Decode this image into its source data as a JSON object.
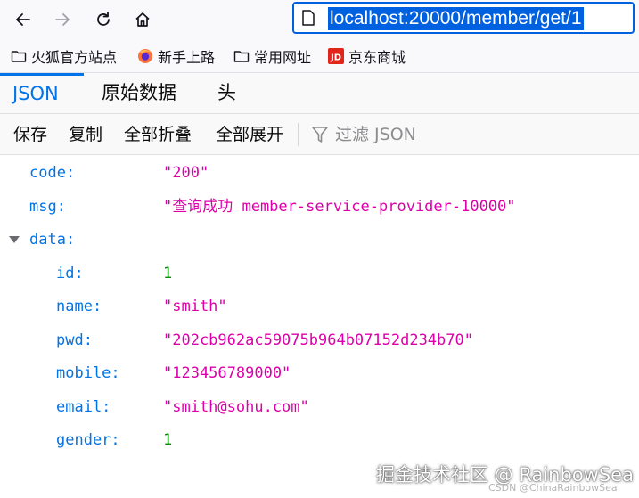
{
  "browser": {
    "url": "localhost:20000/member/get/1",
    "bookmarks": [
      {
        "label": "火狐官方站点",
        "icon": "folder-icon"
      },
      {
        "label": "新手上路",
        "icon": "firefox-icon"
      },
      {
        "label": "常用网址",
        "icon": "folder-icon"
      },
      {
        "label": "京东商城",
        "icon": "jd-icon"
      }
    ]
  },
  "viewer": {
    "tabs": [
      "JSON",
      "原始数据",
      "头"
    ],
    "toolbar": {
      "save": "保存",
      "copy": "复制",
      "collapse_all": "全部折叠",
      "expand_all": "全部展开",
      "filter_placeholder": "过滤 JSON"
    }
  },
  "json": {
    "code": {
      "key": "code:",
      "value": "\"200\""
    },
    "msg": {
      "key": "msg:",
      "value": "\"查询成功 member-service-provider-10000\""
    },
    "data": {
      "key": "data:",
      "id": {
        "key": "id:",
        "value": "1"
      },
      "name": {
        "key": "name:",
        "value": "\"smith\""
      },
      "pwd": {
        "key": "pwd:",
        "value": "\"202cb962ac59075b964b07152d234b70\""
      },
      "mobile": {
        "key": "mobile:",
        "value": "\"123456789000\""
      },
      "email": {
        "key": "email:",
        "value": "\"smith@sohu.com\""
      },
      "gender": {
        "key": "gender:",
        "value": "1"
      }
    }
  },
  "watermark": {
    "main": "掘金技术社区 @ RainbowSea",
    "small": "CSDN @ChinaRainbowSea"
  },
  "colors": {
    "accent": "#0061e0",
    "json_key": "#0074e8",
    "json_string": "#dd00a9",
    "json_number": "#058b00"
  }
}
